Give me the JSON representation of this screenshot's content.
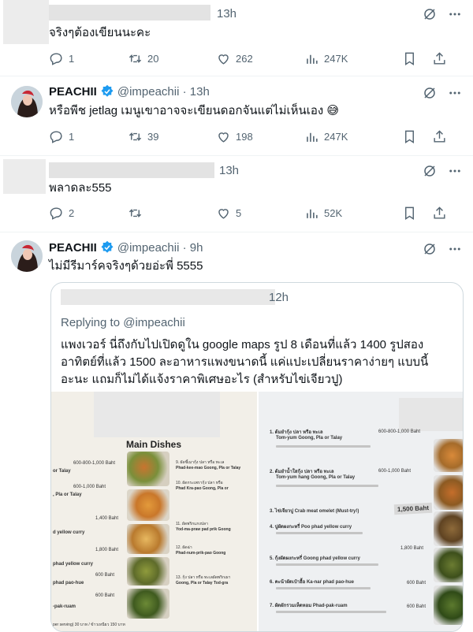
{
  "colors": {
    "accent": "#1d9bf0",
    "muted": "#536471",
    "like": "#536471"
  },
  "tweets": [
    {
      "name": "",
      "handle": "",
      "time": "13h",
      "text": "จริงๆต้องเขียนนะคะ",
      "replies": "1",
      "retweets": "20",
      "likes": "262",
      "views": "247K"
    },
    {
      "name": "PEACHII",
      "handle": "@impeachii",
      "time": "13h",
      "text": "หรือพีช jetlag เมนูเขาอาจจะเขียนดอกจันแต่ไม่เห็นเอง 😅",
      "replies": "1",
      "retweets": "39",
      "likes": "198",
      "views": "247K"
    },
    {
      "name": "",
      "handle": "",
      "time": "13h",
      "text": "พลาดละ555",
      "replies": "2",
      "retweets": "",
      "likes": "5",
      "views": "52K"
    },
    {
      "name": "PEACHII",
      "handle": "@impeachii",
      "time": "9h",
      "text": "ไม่มีรีมาร์คจริงๆด้วยอ่ะพี่ 5555"
    }
  ],
  "quote": {
    "time": "12h",
    "replying_to": "Replying to @impeachii",
    "text": "แพงเวอร์ นี่ถึงกับไปเปิดดูใน google maps รูป 8 เดือนที่แล้ว 1400 รูปสองอาทิตย์ที่แล้ว 1500 ละอาหารแพงขนาดนี้ แค่แปะเปลี่ยนราคาง่ายๆ แบบนี้อะนะ แถมก็ไม่ได้แจ้งราคาพิเศษอะไร (สำหรับไข่เจียวปู)",
    "menu_left": {
      "title": "Main Dishes",
      "items": [
        "600-800-1,000 Baht",
        "or Talay",
        "600-1,000 Baht",
        ", Pla or Talay",
        "1,400 Baht",
        "d yellow curry",
        "1,800 Baht",
        "phad yellow curry",
        "600 Baht",
        "phad pao-hue",
        "600 Baht",
        "-pak-ruam",
        "9. ผัดขี้เมากุ้ง ปลา หรือ ทะเล",
        "Phad-kee-mao Goong, Pla or Talay",
        "10. ผัดกระเพรากุ้ง ปลา หรือ",
        "Phad Kra-pao Goong, Pla or",
        "11. ผัดพริกแกงปลา",
        "Yod-ma-praw pad prik Goong",
        "12. ผัดฉ่า",
        "Phad-num-prik-pao Goong",
        "13. กุ้ง ปลา หรือ ทะเลผัดพริกเผา",
        "Goong, Pla or Talay Tod-gra",
        "per serving) 30 บาท / ข้าวเหนียว 150 บาท"
      ]
    },
    "menu_right": {
      "items": [
        "1. ต้มยำกุ้ง ปลา หรือ ทะเล",
        "Tom-yum Goong, Pla or Talay",
        "600-800-1,000 Baht",
        "2. ต้มยำน้ำใสกุ้ง ปลา หรือ ทะเล",
        "Tom-yum hang Goong, Pla or Talay",
        "600-1,000 Baht",
        "3. ไข่เจียวปู Crab meat omelet (Must-try!)",
        "1,500 Baht",
        "4. ปูผัดผงกะหรี่ Poo phad yellow curry",
        "1,800 Baht",
        "5. กุ้งผัดผงกะหรี่ Goong phad yellow curry",
        "6. คะน้าผัดเป๋าฮื้อ Ka-nar phad pao-hue",
        "600 Baht",
        "7. ผัดผักรวมเห็ดหอม Phad-pak-ruam",
        "600 Baht"
      ]
    }
  }
}
